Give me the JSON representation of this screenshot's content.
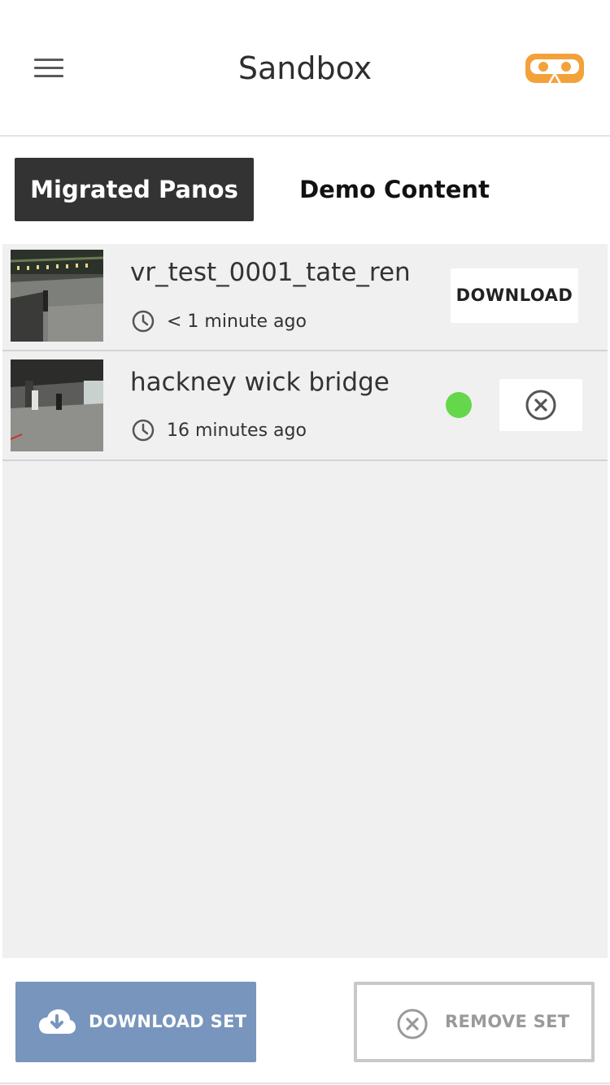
{
  "header": {
    "title": "Sandbox",
    "menu_icon": "hamburger-menu-icon",
    "vr_icon": "vr-headset-icon",
    "vr_color": "#f3a23a"
  },
  "tabs": [
    {
      "label": "Migrated Panos",
      "active": true
    },
    {
      "label": "Demo Content",
      "active": false
    }
  ],
  "items": [
    {
      "title": "vr_test_0001_tate_ren",
      "time": "< 1 minute ago",
      "action": "DOWNLOAD",
      "downloaded": false
    },
    {
      "title": "hackney wick bridge",
      "time": "16 minutes ago",
      "action_icon": "remove-circle-icon",
      "downloaded": true,
      "status_color": "#64d74a"
    }
  ],
  "footer": {
    "download_set_label": "DOWNLOAD SET",
    "remove_set_label": "REMOVE SET",
    "download_set_color": "#7895bd"
  }
}
